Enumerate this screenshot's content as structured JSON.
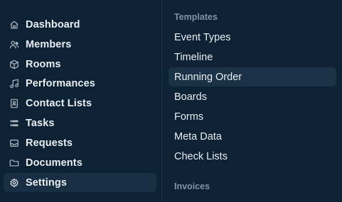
{
  "sidebar": {
    "items": [
      {
        "label": "Dashboard",
        "icon": "home-icon"
      },
      {
        "label": "Members",
        "icon": "users-icon"
      },
      {
        "label": "Rooms",
        "icon": "cube-icon"
      },
      {
        "label": "Performances",
        "icon": "music-note-icon"
      },
      {
        "label": "Contact Lists",
        "icon": "contact-book-icon"
      },
      {
        "label": "Tasks",
        "icon": "task-list-icon"
      },
      {
        "label": "Requests",
        "icon": "inbox-icon"
      },
      {
        "label": "Documents",
        "icon": "folder-icon"
      },
      {
        "label": "Settings",
        "icon": "gear-icon",
        "active": true
      }
    ]
  },
  "settings_menu": {
    "templates_title": "Templates",
    "items": [
      {
        "label": "Event Types"
      },
      {
        "label": "Timeline"
      },
      {
        "label": "Running Order",
        "active": true
      },
      {
        "label": "Boards"
      },
      {
        "label": "Forms"
      },
      {
        "label": "Meta Data"
      },
      {
        "label": "Check Lists"
      }
    ],
    "invoices_title": "Invoices"
  },
  "colors": {
    "background": "#0d2234",
    "active_bg": "#182e42",
    "text": "#e9eef3",
    "muted": "#8393a3"
  }
}
